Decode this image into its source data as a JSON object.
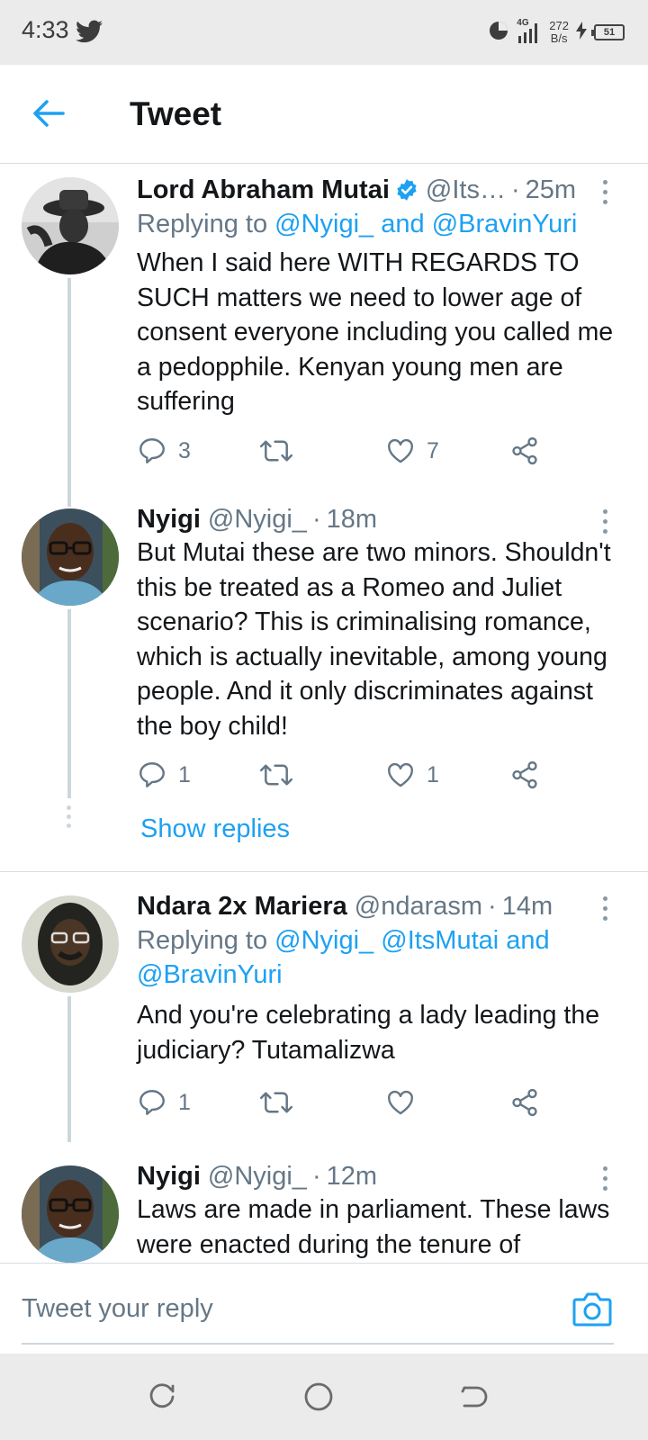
{
  "status_bar": {
    "time": "4:33",
    "network": "4G",
    "speed_value": "272",
    "speed_unit": "B/s",
    "battery": "51"
  },
  "header": {
    "title": "Tweet"
  },
  "tweets": [
    {
      "name": "Lord Abraham Mutai",
      "verified": true,
      "handle": "@Its…",
      "time": "25m",
      "replying_prefix": "Replying to",
      "replying_to": [
        "@Nyigi_",
        "@BravinYuri"
      ],
      "text": "When I said here WITH REGARDS TO SUCH matters we need to lower age of consent everyone including you called me a pedopphile. Kenyan young men are suffering",
      "replies": "3",
      "retweets": "",
      "likes": "7"
    },
    {
      "name": "Nyigi",
      "verified": false,
      "handle": "@Nyigi_",
      "time": "18m",
      "text": "But Mutai these are two minors. Shouldn't this be treated as a Romeo and Juliet scenario? This is criminalising romance, which is actually inevitable, among young people. And it only discriminates against the boy child!",
      "replies": "1",
      "retweets": "",
      "likes": "1",
      "show_replies": "Show replies"
    },
    {
      "name": "Ndara 2x Mariera",
      "verified": false,
      "handle": "@ndarasm",
      "time": "14m",
      "replying_prefix": "Replying to",
      "replying_to": [
        "@Nyigi_",
        "@ItsMutai",
        "@BravinYuri"
      ],
      "text": "And you're celebrating a lady leading the judiciary? Tutamalizwa",
      "replies": "1",
      "retweets": "",
      "likes": ""
    },
    {
      "name": "Nyigi",
      "verified": false,
      "handle": "@Nyigi_",
      "time": "12m",
      "text": "Laws are made in parliament. These laws were enacted during the tenure of"
    }
  ],
  "words": {
    "and": "and",
    "dot": "·"
  },
  "reply_bar": {
    "placeholder": "Tweet your reply"
  },
  "colors": {
    "accent": "#1da1f2",
    "secondary_text": "#657786",
    "primary_text": "#14171a",
    "thread_line": "#ccd6dd",
    "system_bar": "#ebebeb"
  },
  "icons": [
    "back-arrow-icon",
    "verified-badge-icon",
    "more-vertical-icon",
    "reply-icon",
    "retweet-icon",
    "like-icon",
    "share-icon",
    "camera-icon"
  ]
}
